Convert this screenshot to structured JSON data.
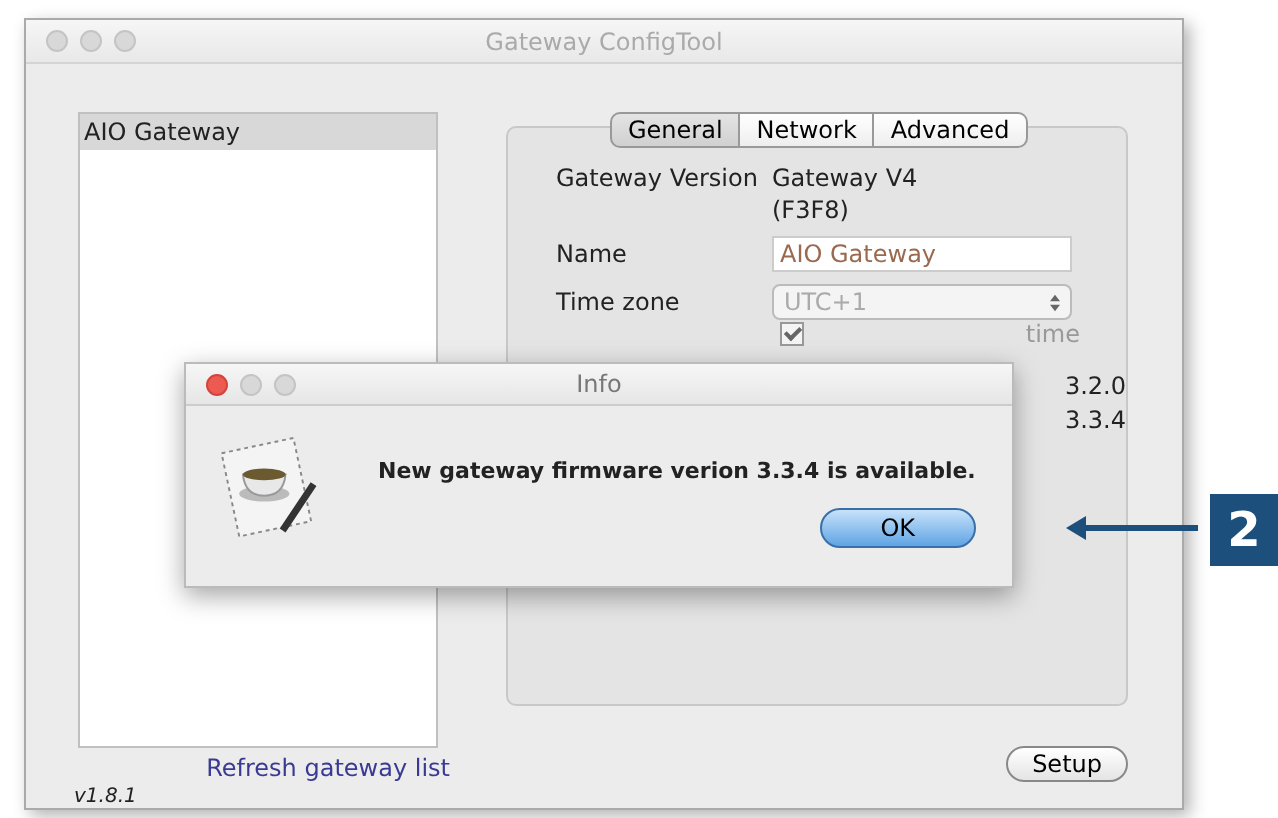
{
  "window": {
    "title": "Gateway ConfigTool"
  },
  "gateway_list": {
    "items": [
      {
        "label": "AIO Gateway",
        "selected": true
      }
    ],
    "refresh_link": "Refresh gateway list"
  },
  "version": "v1.8.1",
  "tabs": [
    {
      "label": "General",
      "selected": true
    },
    {
      "label": "Network",
      "selected": false
    },
    {
      "label": "Advanced",
      "selected": false
    }
  ],
  "general": {
    "gateway_version_label": "Gateway Version",
    "gateway_version": "Gateway V4",
    "gateway_code": "(F3F8)",
    "name_label": "Name",
    "name_value": "AIO Gateway",
    "time_zone_label": "Time zone",
    "time_zone_value": "UTC+1",
    "daylight_saving": {
      "label": "time",
      "checked": true
    },
    "values": [
      "3.2.0",
      "3.3.4"
    ]
  },
  "setup_button": "Setup",
  "dialog": {
    "title": "Info",
    "message": "New gateway firmware verion 3.3.4 is available.",
    "button": "OK"
  },
  "callout": {
    "number": "2"
  }
}
